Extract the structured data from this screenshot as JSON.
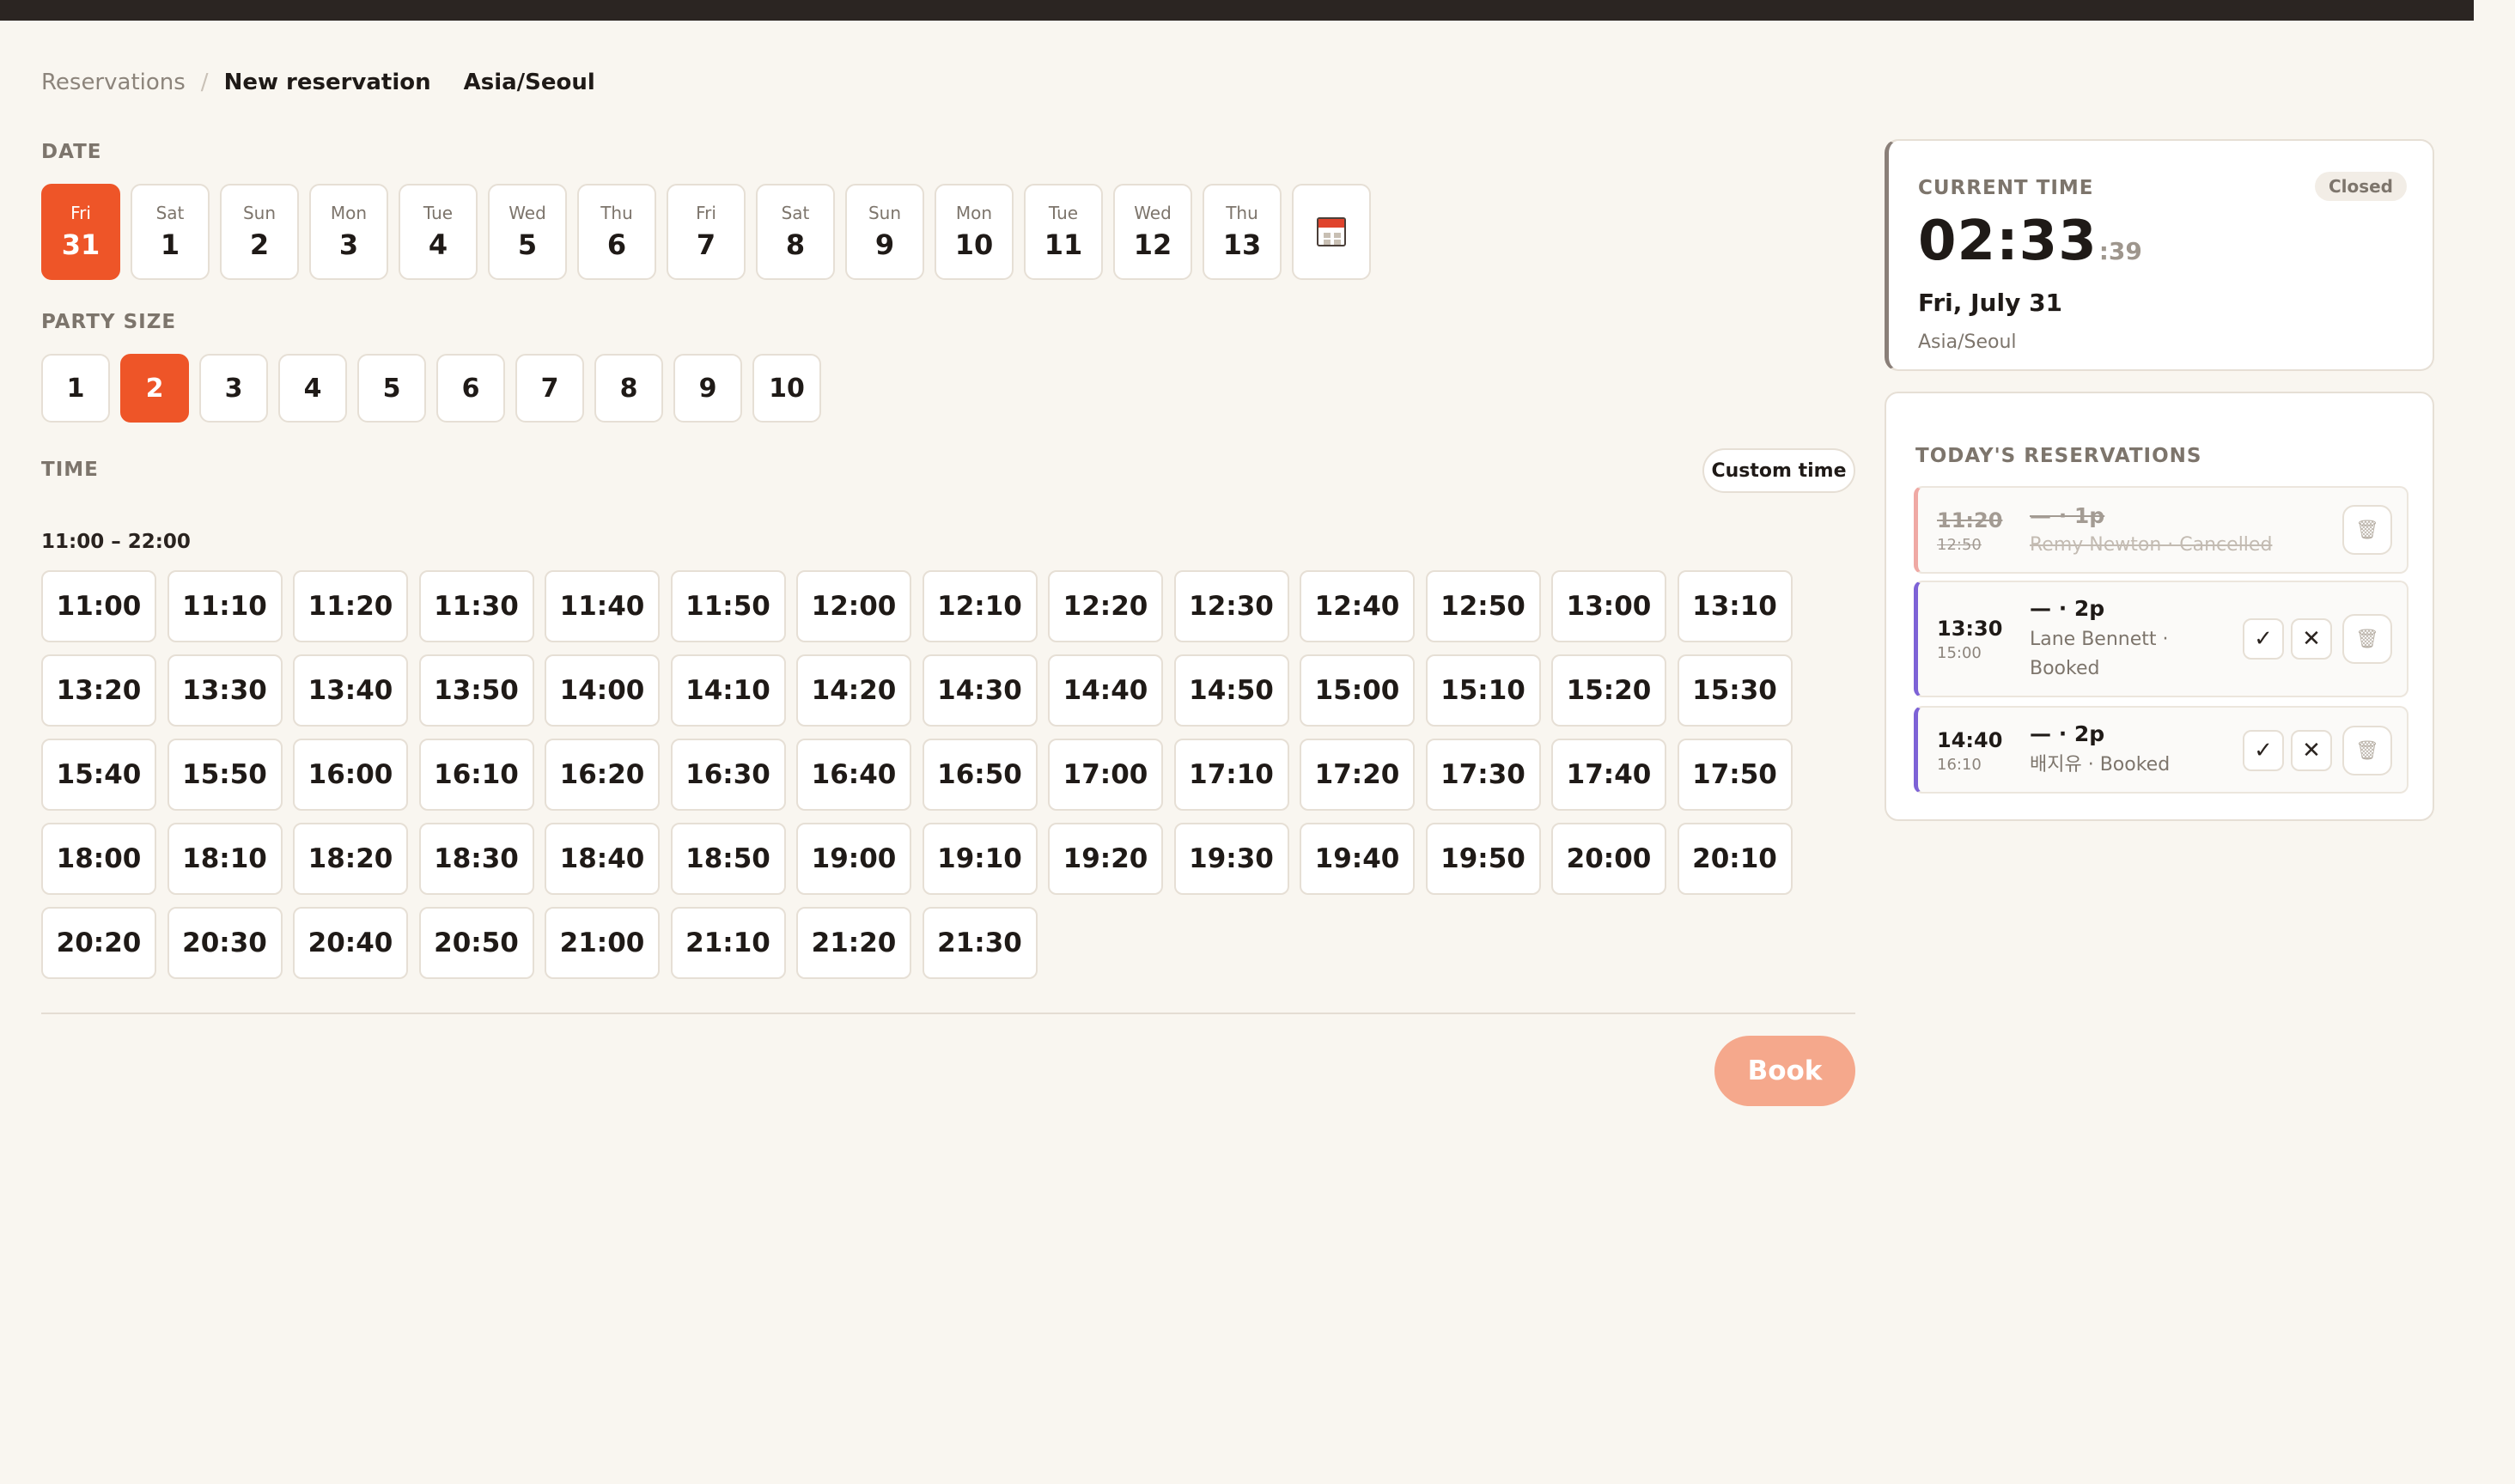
{
  "breadcrumb": {
    "root": "Reservations",
    "separator": "/",
    "current": "New reservation",
    "timezone": "Asia/Seoul"
  },
  "date_section": {
    "label": "DATE",
    "days": [
      {
        "dow": "Fri",
        "day": "31",
        "selected": true
      },
      {
        "dow": "Sat",
        "day": "1"
      },
      {
        "dow": "Sun",
        "day": "2"
      },
      {
        "dow": "Mon",
        "day": "3"
      },
      {
        "dow": "Tue",
        "day": "4"
      },
      {
        "dow": "Wed",
        "day": "5"
      },
      {
        "dow": "Thu",
        "day": "6"
      },
      {
        "dow": "Fri",
        "day": "7"
      },
      {
        "dow": "Sat",
        "day": "8"
      },
      {
        "dow": "Sun",
        "day": "9"
      },
      {
        "dow": "Mon",
        "day": "10"
      },
      {
        "dow": "Tue",
        "day": "11"
      },
      {
        "dow": "Wed",
        "day": "12"
      },
      {
        "dow": "Thu",
        "day": "13"
      }
    ],
    "calendar_icon": "calendar-icon"
  },
  "party_section": {
    "label": "PARTY SIZE",
    "sizes": [
      "1",
      "2",
      "3",
      "4",
      "5",
      "6",
      "7",
      "8",
      "9",
      "10"
    ],
    "selected": "2"
  },
  "time_section": {
    "label": "TIME",
    "custom_button": "Custom time",
    "range": "11:00 – 22:00",
    "slots": [
      "11:00",
      "11:10",
      "11:20",
      "11:30",
      "11:40",
      "11:50",
      "12:00",
      "12:10",
      "12:20",
      "12:30",
      "12:40",
      "12:50",
      "13:00",
      "13:10",
      "13:20",
      "13:30",
      "13:40",
      "13:50",
      "14:00",
      "14:10",
      "14:20",
      "14:30",
      "14:40",
      "14:50",
      "15:00",
      "15:10",
      "15:20",
      "15:30",
      "15:40",
      "15:50",
      "16:00",
      "16:10",
      "16:20",
      "16:30",
      "16:40",
      "16:50",
      "17:00",
      "17:10",
      "17:20",
      "17:30",
      "17:40",
      "17:50",
      "18:00",
      "18:10",
      "18:20",
      "18:30",
      "18:40",
      "18:50",
      "19:00",
      "19:10",
      "19:20",
      "19:30",
      "19:40",
      "19:50",
      "20:00",
      "20:10",
      "20:20",
      "20:30",
      "20:40",
      "20:50",
      "21:00",
      "21:10",
      "21:20",
      "21:30"
    ]
  },
  "book_button": "Book",
  "clock": {
    "label": "CURRENT TIME",
    "status": "Closed",
    "hm": "02:33",
    "sec": ":39",
    "date": "Fri, July 31",
    "timezone": "Asia/Seoul"
  },
  "reservations": {
    "title": "TODAY'S RESERVATIONS",
    "items": [
      {
        "start": "11:20",
        "end": "12:50",
        "party": "— · 1p",
        "meta": "Remy Newton · Cancelled",
        "status": "cancelled"
      },
      {
        "start": "13:30",
        "end": "15:00",
        "party": "— · 2p",
        "meta": "Lane Bennett · Booked",
        "status": "booked"
      },
      {
        "start": "14:40",
        "end": "16:10",
        "party": "— · 2p",
        "meta": "배지유 · Booked",
        "status": "booked"
      }
    ],
    "icons": {
      "confirm": "✓",
      "cancel": "✕",
      "delete": "🗑"
    }
  },
  "colors": {
    "accent": "#ee5528",
    "book_disabled": "#f5a88c",
    "booked_bar": "#7d62d6",
    "cancelled_bar": "#efa9a4",
    "background": "#f9f6f0"
  }
}
